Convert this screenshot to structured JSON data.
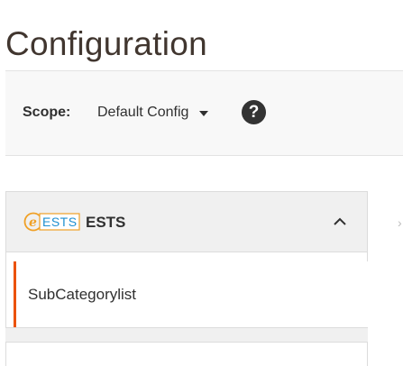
{
  "page": {
    "title": "Configuration"
  },
  "scope": {
    "label": "Scope:",
    "selected": "Default Config",
    "help_symbol": "?"
  },
  "panel": {
    "logo_text": "ESTS",
    "title": "ESTS",
    "items": [
      {
        "label": "SubCategorylist"
      }
    ]
  },
  "colors": {
    "accent": "#eb5202",
    "logo_blue": "#1e8fd0",
    "logo_orange": "#f0a025"
  }
}
